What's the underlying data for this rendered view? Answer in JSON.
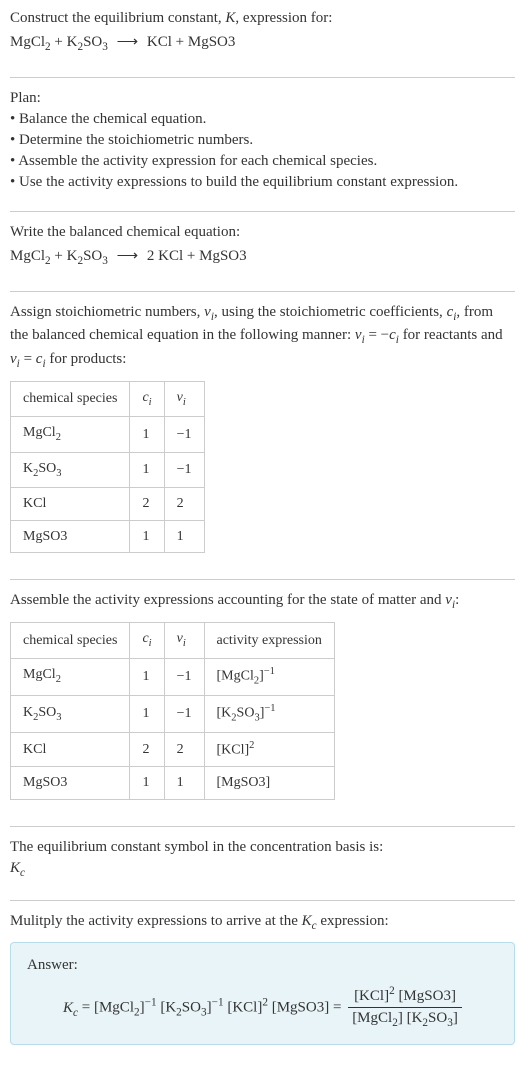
{
  "title_line1": "Construct the equilibrium constant, K, expression for:",
  "title_equation": "MgCl₂ + K₂SO₃  ⟶  KCl + MgSO3",
  "plan_heading": "Plan:",
  "plan_items": [
    "Balance the chemical equation.",
    "Determine the stoichiometric numbers.",
    "Assemble the activity expression for each chemical species.",
    "Use the activity expressions to build the equilibrium constant expression."
  ],
  "balanced_heading": "Write the balanced chemical equation:",
  "balanced_equation": "MgCl₂ + K₂SO₃  ⟶  2 KCl + MgSO3",
  "stoich_text": "Assign stoichiometric numbers, νᵢ, using the stoichiometric coefficients, cᵢ, from the balanced chemical equation in the following manner: νᵢ = −cᵢ for reactants and νᵢ = cᵢ for products:",
  "table1": {
    "headers": [
      "chemical species",
      "cᵢ",
      "νᵢ"
    ],
    "rows": [
      [
        "MgCl₂",
        "1",
        "−1"
      ],
      [
        "K₂SO₃",
        "1",
        "−1"
      ],
      [
        "KCl",
        "2",
        "2"
      ],
      [
        "MgSO3",
        "1",
        "1"
      ]
    ]
  },
  "activity_text": "Assemble the activity expressions accounting for the state of matter and νᵢ:",
  "table2": {
    "headers": [
      "chemical species",
      "cᵢ",
      "νᵢ",
      "activity expression"
    ],
    "rows": [
      [
        "MgCl₂",
        "1",
        "−1",
        "[MgCl₂]⁻¹"
      ],
      [
        "K₂SO₃",
        "1",
        "−1",
        "[K₂SO₃]⁻¹"
      ],
      [
        "KCl",
        "2",
        "2",
        "[KCl]²"
      ],
      [
        "MgSO3",
        "1",
        "1",
        "[MgSO3]"
      ]
    ]
  },
  "eq_constant_text": "The equilibrium constant symbol in the concentration basis is:",
  "eq_constant_symbol": "K꜀",
  "multiply_text": "Mulitply the activity expressions to arrive at the K꜀ expression:",
  "answer_label": "Answer:",
  "answer_lhs": "K꜀ = [MgCl₂]⁻¹ [K₂SO₃]⁻¹ [KCl]² [MgSO3] = ",
  "answer_num": "[KCl]² [MgSO3]",
  "answer_den": "[MgCl₂] [K₂SO₃]"
}
